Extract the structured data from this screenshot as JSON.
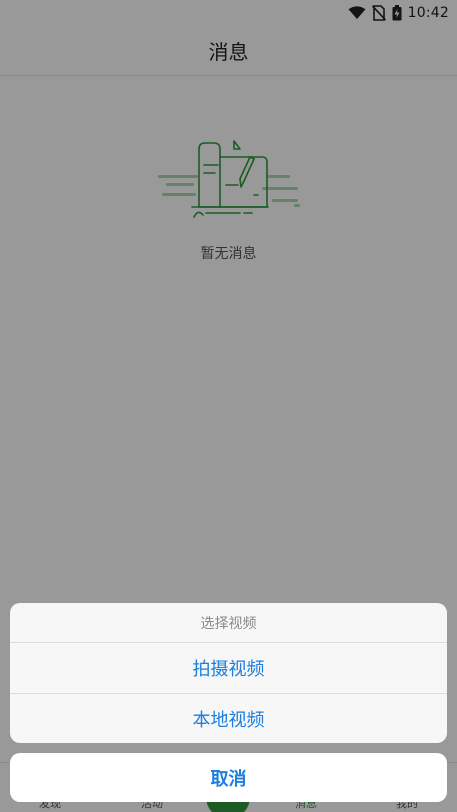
{
  "status_bar": {
    "time": "10:42",
    "icons": [
      "wifi-icon",
      "no-sim-icon",
      "battery-charging-icon"
    ]
  },
  "header": {
    "title": "消息"
  },
  "empty_state": {
    "text": "暂无消息",
    "icon": "empty-messages-illustration"
  },
  "tab_bar": {
    "items": [
      {
        "label": "发现",
        "icon": "discover-icon",
        "active": false
      },
      {
        "label": "活动",
        "icon": "activity-icon",
        "active": false
      },
      {
        "label": "",
        "icon": "publish-button",
        "active": false
      },
      {
        "label": "消息",
        "icon": "message-icon",
        "active": true
      },
      {
        "label": "我的",
        "icon": "profile-icon",
        "active": false
      }
    ]
  },
  "action_sheet": {
    "title": "选择视频",
    "options": [
      {
        "label": "拍摄视频"
      },
      {
        "label": "本地视频"
      }
    ],
    "cancel_label": "取消"
  },
  "colors": {
    "accent_green": "#2e9a3c",
    "action_blue": "#1a7fe0",
    "overlay": "rgba(0,0,0,0.4)"
  }
}
